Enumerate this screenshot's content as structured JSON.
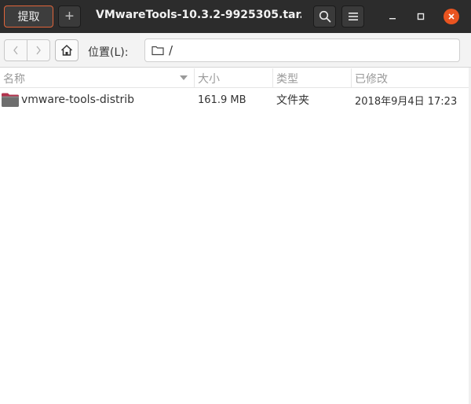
{
  "header": {
    "extract_label": "提取",
    "add_label": "+",
    "title": "VMwareTools-10.3.2-9925305.tar.gz...",
    "search_icon": "search-icon",
    "menu_icon": "hamburger-menu-icon"
  },
  "window_controls": {
    "minimize_icon": "minimize-icon",
    "maximize_icon": "maximize-icon",
    "close_icon": "close-icon",
    "close_color": "#e95420"
  },
  "location": {
    "back_icon": "chevron-left-icon",
    "forward_icon": "chevron-right-icon",
    "home_icon": "home-icon",
    "label": "位置(L):",
    "folder_icon": "folder-icon",
    "path": "/"
  },
  "columns": {
    "name": "名称",
    "size": "大小",
    "type": "类型",
    "modified": "已修改"
  },
  "files": [
    {
      "name": "vmware-tools-distrib",
      "size": "161.9 MB",
      "type": "文件夹",
      "modified": "2018年9月4日 17:23",
      "icon": "folder-icon"
    }
  ]
}
